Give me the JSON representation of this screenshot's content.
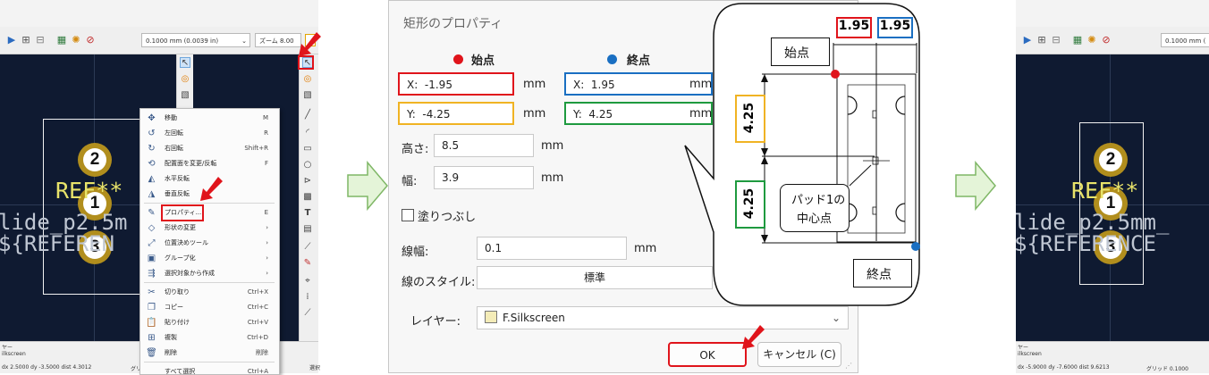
{
  "colors": {
    "red": "#e0141b",
    "blue": "#1a6fc2",
    "orange": "#f0b323",
    "green": "#1e9a3f",
    "pad": "#b18e1d",
    "canvas": "#0f1a31"
  },
  "left_panel": {
    "grid_combo": "0.1000 mm (0.0039 in)",
    "zoom_combo": "ズーム 8.00",
    "ref_text": "REF**",
    "value_text_1": "lide_p2.5m",
    "value_text_2": "${REFEREN",
    "pads": [
      "2",
      "1",
      "3"
    ],
    "status": {
      "layer_label": "ヤー",
      "layer_value": "ilkscreen",
      "coords": "dx 2.5000  dy -3.5000  dist 4.3012",
      "grid": "グリ",
      "selection": "選択"
    },
    "context_menu": [
      {
        "icon": "move-icon",
        "glyph": "✥",
        "label": "移動",
        "shortcut": "M"
      },
      {
        "icon": "rotate-left-icon",
        "glyph": "↺",
        "label": "左回転",
        "shortcut": "R"
      },
      {
        "icon": "rotate-right-icon",
        "glyph": "↻",
        "label": "右回転",
        "shortcut": "Shift+R"
      },
      {
        "icon": "flip-board-icon",
        "glyph": "⟲",
        "label": "配置面を変更/反転",
        "shortcut": "F"
      },
      {
        "icon": "mirror-horizontal-icon",
        "glyph": "◭",
        "label": "水平反転",
        "shortcut": ""
      },
      {
        "icon": "mirror-vertical-icon",
        "glyph": "◮",
        "label": "垂直反転",
        "shortcut": ""
      },
      {
        "icon": "properties-icon",
        "glyph": "✎",
        "label": "プロパティ...",
        "shortcut": "E"
      },
      {
        "icon": "shape-modify-icon",
        "glyph": "◇",
        "label": "形状の変更",
        "shortcut": "›"
      },
      {
        "icon": "position-tool-icon",
        "glyph": "⤢",
        "label": "位置決めツール",
        "shortcut": "›"
      },
      {
        "icon": "group-icon",
        "glyph": "▣",
        "label": "グループ化",
        "shortcut": "›"
      },
      {
        "icon": "create-from-selection-icon",
        "glyph": "⇶",
        "label": "選択対象から作成",
        "shortcut": "›"
      },
      {
        "icon": "cut-icon",
        "glyph": "✂",
        "label": "切り取り",
        "shortcut": "Ctrl+X"
      },
      {
        "icon": "copy-icon",
        "glyph": "❐",
        "label": "コピー",
        "shortcut": "Ctrl+C"
      },
      {
        "icon": "paste-icon",
        "glyph": "📋",
        "label": "貼り付け",
        "shortcut": "Ctrl+V"
      },
      {
        "icon": "duplicate-icon",
        "glyph": "⊞",
        "label": "複製",
        "shortcut": "Ctrl+D"
      },
      {
        "icon": "delete-icon",
        "glyph": "🗑",
        "label": "削除",
        "shortcut": "削除"
      },
      {
        "icon": "select-all-icon",
        "glyph": "",
        "label": "すべて選択",
        "shortcut": "Ctrl+A"
      }
    ]
  },
  "dialog": {
    "title": "矩形のプロパティ",
    "start_label": "始点",
    "end_label": "終点",
    "x_prefix": "X:",
    "y_prefix": "Y:",
    "start_x": "-1.95",
    "start_y": "-4.25",
    "end_x": "1.95",
    "end_y": "4.25",
    "unit": "mm",
    "height_label": "高さ:",
    "height_value": "8.5",
    "width_label": "幅:",
    "width_value": "3.9",
    "fill_label": "塗りつぶし",
    "line_width_label": "線幅:",
    "line_width_value": "0.1",
    "line_style_label": "線のスタイル:",
    "line_style_value": "標準",
    "layer_label": "レイヤー:",
    "layer_value": "F.Silkscreen",
    "ok": "OK",
    "cancel": "キャンセル (C)"
  },
  "callout": {
    "start_point": "始点",
    "end_point": "終点",
    "dim_left": "1.95",
    "dim_right": "1.95",
    "dim_upper": "4.25",
    "dim_lower": "4.25",
    "pad1_center_line1": "パッド1の",
    "pad1_center_line2": "中心点"
  },
  "right_panel": {
    "grid_combo": "0.1000 mm (",
    "ref_text": "REF**",
    "value_text_1": "lide_p2.5mm_",
    "value_text_2": "${REFERENCE",
    "pads": [
      "2",
      "1",
      "3"
    ],
    "status": {
      "layer_label": "ヤー",
      "layer_value": "ilkscreen",
      "coords": "dx -5.9000  dy -7.6000  dist 9.6213",
      "grid": "グリッド 0.1000"
    }
  }
}
